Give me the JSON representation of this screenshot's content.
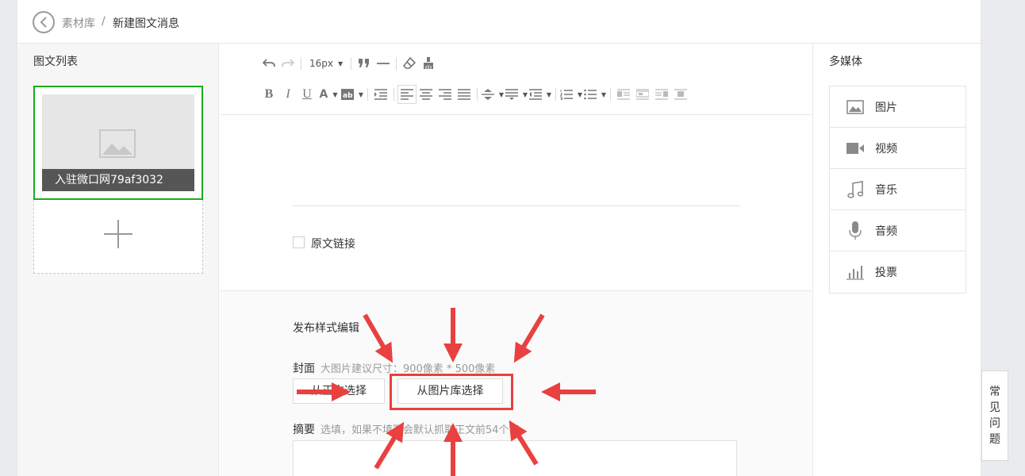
{
  "breadcrumb": {
    "library": "素材库",
    "separator": "/",
    "current": "新建图文消息"
  },
  "left_panel": {
    "title": "图文列表",
    "article": {
      "title": "入驻微口网79af3032"
    }
  },
  "toolbar": {
    "font_size": "16px",
    "row1": [
      "undo-icon",
      "redo-icon",
      "font-size-select",
      "blockquote-icon",
      "horizontal-rule-icon",
      "eraser-icon",
      "format-painter-icon"
    ],
    "row2": [
      "bold-icon",
      "italic-icon",
      "underline-icon",
      "font-color-icon",
      "background-color-icon",
      "indent-icon",
      "align-left-icon",
      "align-center-icon",
      "align-right-icon",
      "align-justify-icon",
      "line-height-icon",
      "paragraph-spacing-icon",
      "letter-spacing-icon",
      "ordered-list-icon",
      "unordered-list-icon",
      "float-left-icon",
      "float-none-icon",
      "float-right-icon",
      "center-icon"
    ]
  },
  "editor": {
    "source_link_label": "原文链接"
  },
  "publish": {
    "title": "发布样式编辑",
    "cover_label": "封面",
    "cover_hint": "大图片建议尺寸：900像素 * 500像素",
    "from_body_label": "从正文选择",
    "from_library_label": "从图片库选择",
    "summary_label": "摘要",
    "summary_hint": "选填，如果不填写会默认抓取正文前54个字"
  },
  "right_panel": {
    "title": "多媒体",
    "items": [
      {
        "label": "图片",
        "icon": "image-icon"
      },
      {
        "label": "视频",
        "icon": "video-icon"
      },
      {
        "label": "音乐",
        "icon": "music-icon"
      },
      {
        "label": "音频",
        "icon": "microphone-icon"
      },
      {
        "label": "投票",
        "icon": "vote-icon"
      }
    ]
  },
  "faq": {
    "label": [
      "常",
      "见",
      "问",
      "题"
    ]
  },
  "colors": {
    "selected_border": "#1aad19",
    "annotation_red": "#e94040",
    "thumb_caption_bg": "#3c3c3c"
  }
}
